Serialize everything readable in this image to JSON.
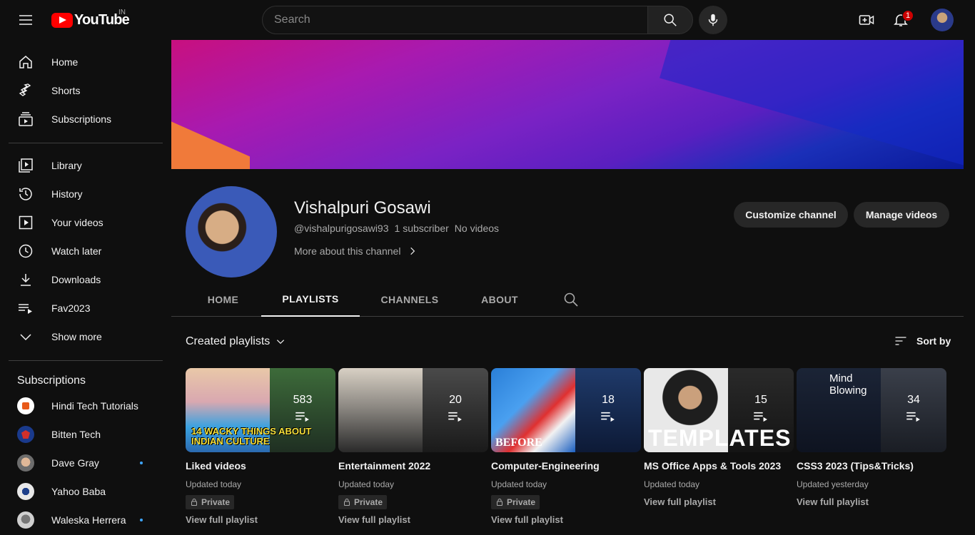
{
  "header": {
    "logo_text": "YouTube",
    "country_code": "IN",
    "search_placeholder": "Search",
    "notification_count": "1"
  },
  "sidebar": {
    "primary": [
      {
        "label": "Home",
        "icon": "home-icon"
      },
      {
        "label": "Shorts",
        "icon": "shorts-icon"
      },
      {
        "label": "Subscriptions",
        "icon": "subscriptions-icon"
      }
    ],
    "library": [
      {
        "label": "Library",
        "icon": "library-icon"
      },
      {
        "label": "History",
        "icon": "history-icon"
      },
      {
        "label": "Your videos",
        "icon": "your-videos-icon"
      },
      {
        "label": "Watch later",
        "icon": "watch-later-icon"
      },
      {
        "label": "Downloads",
        "icon": "downloads-icon"
      },
      {
        "label": "Fav2023",
        "icon": "playlist-icon"
      },
      {
        "label": "Show more",
        "icon": "chevron-down-icon"
      }
    ],
    "subscriptions_heading": "Subscriptions",
    "subscriptions": [
      {
        "label": "Hindi Tech Tutorials",
        "color": "#ffffff",
        "new": false
      },
      {
        "label": "Bitten Tech",
        "color": "#1a3a8c",
        "new": false
      },
      {
        "label": "Dave Gray",
        "color": "#b88b6a",
        "new": true
      },
      {
        "label": "Yahoo Baba",
        "color": "#e8e8e8",
        "new": false
      },
      {
        "label": "Waleska Herrera",
        "color": "#cfcfcf",
        "new": true
      }
    ]
  },
  "channel": {
    "name": "Vishalpuri Gosawi",
    "handle": "@vishalpurigosawi93",
    "subscribers": "1 subscriber",
    "videos": "No videos",
    "more_about": "More about this channel",
    "customize_label": "Customize channel",
    "manage_label": "Manage videos"
  },
  "tabs": [
    {
      "label": "HOME",
      "active": false
    },
    {
      "label": "PLAYLISTS",
      "active": true
    },
    {
      "label": "CHANNELS",
      "active": false
    },
    {
      "label": "ABOUT",
      "active": false
    }
  ],
  "playlists_section": {
    "title": "Created playlists",
    "sort_label": "Sort by"
  },
  "playlists": [
    {
      "title": "Liked videos",
      "count": "583",
      "updated": "Updated today",
      "private": true,
      "private_label": "Private",
      "link": "View full playlist",
      "thumb_text": "14 WACKY THINGS ABOUT INDIAN CULTURE"
    },
    {
      "title": "Entertainment 2022",
      "count": "20",
      "updated": "Updated today",
      "private": true,
      "private_label": "Private",
      "link": "View full playlist",
      "thumb_text": ""
    },
    {
      "title": "Computer-Engineering",
      "count": "18",
      "updated": "Updated today",
      "private": true,
      "private_label": "Private",
      "link": "View full playlist",
      "thumb_text": "BEFORE"
    },
    {
      "title": "MS Office Apps & Tools 2023",
      "count": "15",
      "updated": "Updated today",
      "private": false,
      "private_label": "",
      "link": "View full playlist",
      "thumb_text": "TEMPLATES"
    },
    {
      "title": "CSS3 2023 (Tips&Tricks)",
      "count": "34",
      "updated": "Updated yesterday",
      "private": false,
      "private_label": "",
      "link": "View full playlist",
      "thumb_text": "Mind Blowing"
    }
  ]
}
